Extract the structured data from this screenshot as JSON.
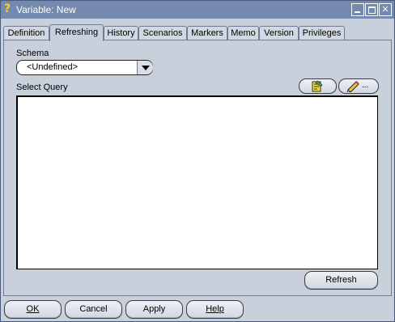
{
  "window": {
    "title": "Variable: New",
    "title_icon": "question-mark-icon",
    "controls": [
      "minimize-icon",
      "maximize-icon",
      "close-icon"
    ]
  },
  "tabs": [
    {
      "label": "Definition",
      "active": false
    },
    {
      "label": "Refreshing",
      "active": true
    },
    {
      "label": "History",
      "active": false
    },
    {
      "label": "Scenarios",
      "active": false
    },
    {
      "label": "Markers",
      "active": false
    },
    {
      "label": "Memo",
      "active": false
    },
    {
      "label": "Version",
      "active": false
    },
    {
      "label": "Privileges",
      "active": false
    }
  ],
  "refreshing": {
    "schema_label": "Schema",
    "schema_value": "<Undefined>",
    "select_query_label": "Select Query",
    "query_text": "",
    "toolbar_icons": [
      "notepad-icon",
      "pencil-icon"
    ],
    "edit_button_suffix": "...",
    "refresh_label": "Refresh"
  },
  "footer": {
    "ok_label": "OK",
    "cancel_label": "Cancel",
    "apply_label": "Apply",
    "help_label": "Help"
  },
  "colors": {
    "titlebar": "#7389ad",
    "background": "#c8d0dc",
    "title_icon": "#ffd400"
  }
}
